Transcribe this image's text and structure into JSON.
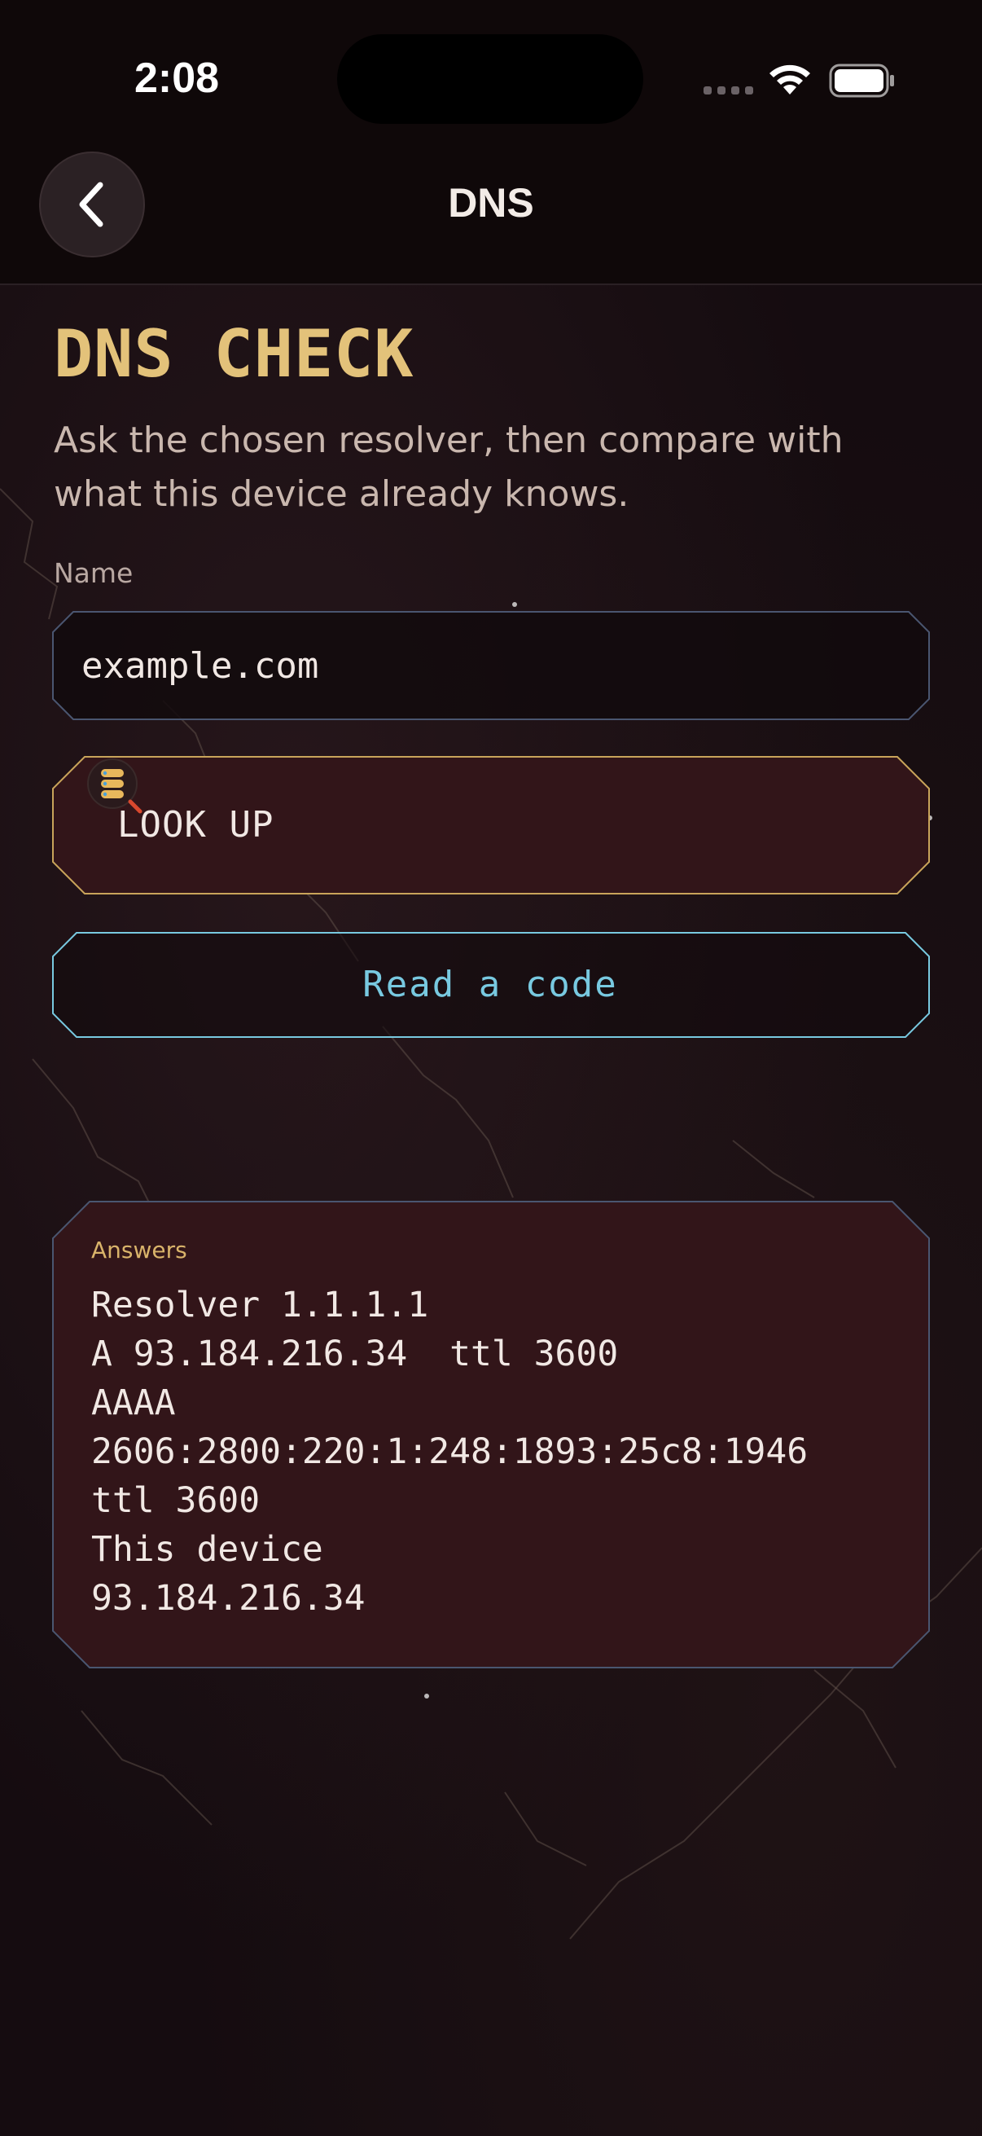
{
  "status_bar": {
    "time": "2:08"
  },
  "nav": {
    "title": "DNS",
    "back_icon": "chevron-left-icon"
  },
  "header": {
    "title": "DNS CHECK",
    "subtitle": "Ask the chosen resolver, then compare with what this device already knows."
  },
  "form": {
    "name_label": "Name",
    "name_value": "example.com"
  },
  "actions": {
    "lookup_label": "LOOK UP",
    "lookup_icon": "dns-search-icon",
    "read_code_label": "Read a code"
  },
  "answers": {
    "title": "Answers",
    "lines": [
      "Resolver 1.1.1.1",
      "A 93.184.216.34  ttl 3600",
      "AAAA",
      "2606:2800:220:1:248:1893:25c8:1946",
      "ttl 3600",
      "This device",
      "93.184.216.34"
    ]
  },
  "colors": {
    "accent_gold": "#e3c27a",
    "accent_cyan": "#78c9e0",
    "panel_maroon": "#321519",
    "background": "#150c10"
  }
}
